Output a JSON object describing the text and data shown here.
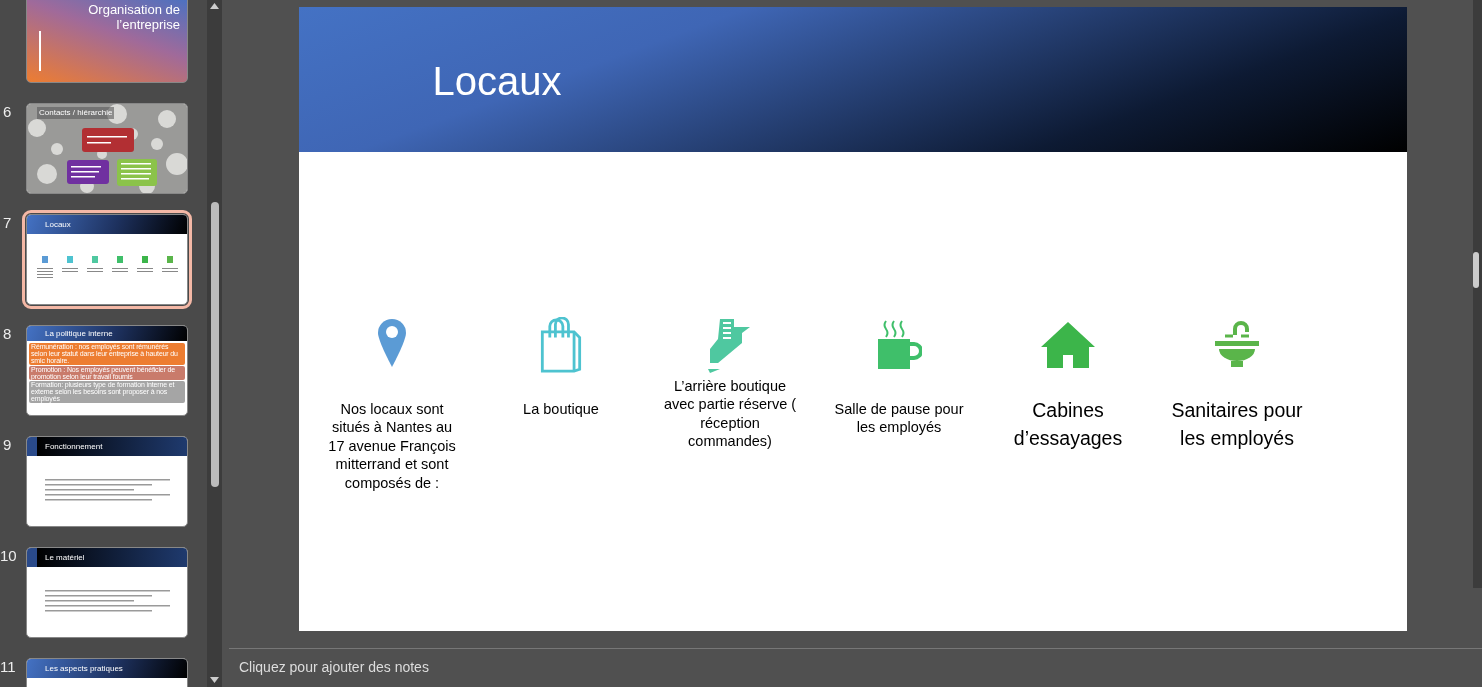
{
  "slide_panel": {
    "slides": [
      {
        "kind": "gradient-title",
        "title": "Organisation de l’entreprise",
        "selected": false
      },
      {
        "number": "6",
        "kind": "photo-chart",
        "title": "Contacts / hiérarchie",
        "selected": false
      },
      {
        "number": "7",
        "kind": "icons",
        "title": "Locaux",
        "selected": true
      },
      {
        "number": "8",
        "kind": "boxes",
        "title": "La politique interne",
        "selected": false,
        "boxes": [
          {
            "text": "Rémunération : nos employés sont rémunérés selon leur statut dans leur entreprise à hauteur du smic horaire.",
            "color": "#ed7d31"
          },
          {
            "text": "Promotion : Nos employés peuvent bénéficier de promotion selon leur travail fournis",
            "color": "#c97b6b"
          },
          {
            "text": "Formation: plusieurs type de formation interne et externe selon les besoins sont proposer à nos employés",
            "color": "#a5a5a5"
          }
        ]
      },
      {
        "number": "9",
        "kind": "dark-lines",
        "title": "Fonctionnement",
        "selected": false
      },
      {
        "number": "10",
        "kind": "dark-lines",
        "title": "Le matériel",
        "selected": false
      },
      {
        "number": "11",
        "kind": "blue-title",
        "title": "Les aspects pratiques",
        "selected": false
      }
    ]
  },
  "slide": {
    "title": "Locaux",
    "items": [
      {
        "kind": "pin",
        "text": "Nos locaux sont situés à Nantes au 17 avenue François mitterrand  et sont composés de :"
      },
      {
        "kind": "bag",
        "text": "La boutique"
      },
      {
        "kind": "tag",
        "text": "L’arrière boutique avec partie réserve ( réception commandes)"
      },
      {
        "kind": "mug",
        "text": "Salle de pause pour les employés"
      },
      {
        "kind": "house",
        "text": "Cabines d’essayages"
      },
      {
        "kind": "sink",
        "text": "Sanitaires pour les employés"
      }
    ]
  },
  "notes": {
    "placeholder": "Cliquez pour ajouter des notes"
  }
}
